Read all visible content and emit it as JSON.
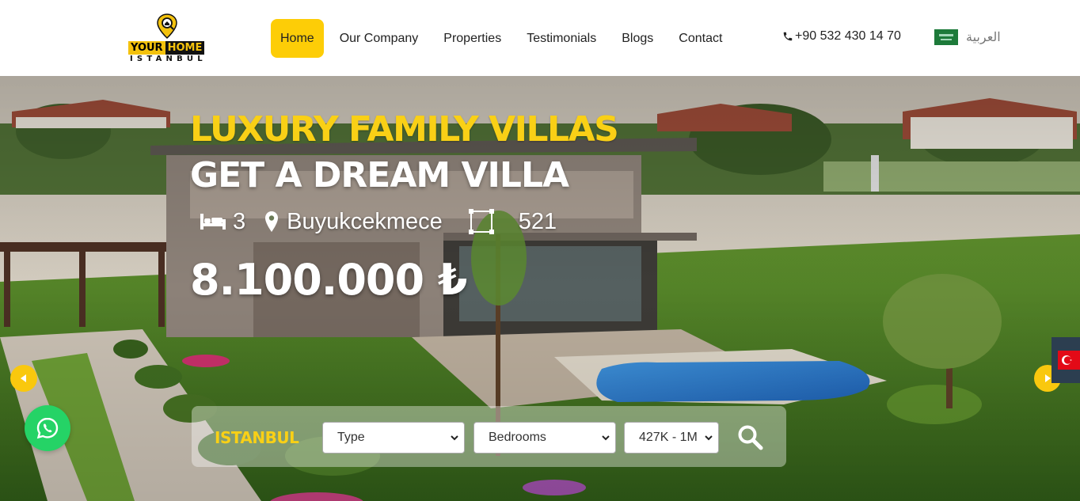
{
  "brand": {
    "logo_line1a": "YOUR",
    "logo_line1b": "HOME",
    "logo_line2": "ISTANBUL"
  },
  "nav": {
    "items": [
      {
        "label": "Home",
        "active": true
      },
      {
        "label": "Our Company"
      },
      {
        "label": "Properties"
      },
      {
        "label": "Testimonials"
      },
      {
        "label": "Blogs"
      },
      {
        "label": "Contact"
      }
    ],
    "phone": "+90 532 430 14 70",
    "language": "العربية"
  },
  "hero": {
    "title": "LUXURY FAMILY VILLAS",
    "subtitle": "GET A DREAM VILLA",
    "bedrooms": "3",
    "location": "Buyukcekmece",
    "area": "521",
    "price": "8.100.000 ₺"
  },
  "search": {
    "city_label": "ISTANBUL",
    "type_value": "Type",
    "bedrooms_value": "Bedrooms",
    "price_value": "427K - 1M"
  },
  "icons": {
    "phone": "phone-icon",
    "bed": "bed-icon",
    "location": "map-pin-icon",
    "area": "area-square-icon",
    "search": "search-icon",
    "whatsapp": "whatsapp-icon",
    "arrow_left": "chevron-left-icon",
    "arrow_right": "chevron-right-icon"
  },
  "colors": {
    "accent": "#fdcd07",
    "whatsapp": "#25d366",
    "nav_text": "#222222"
  }
}
